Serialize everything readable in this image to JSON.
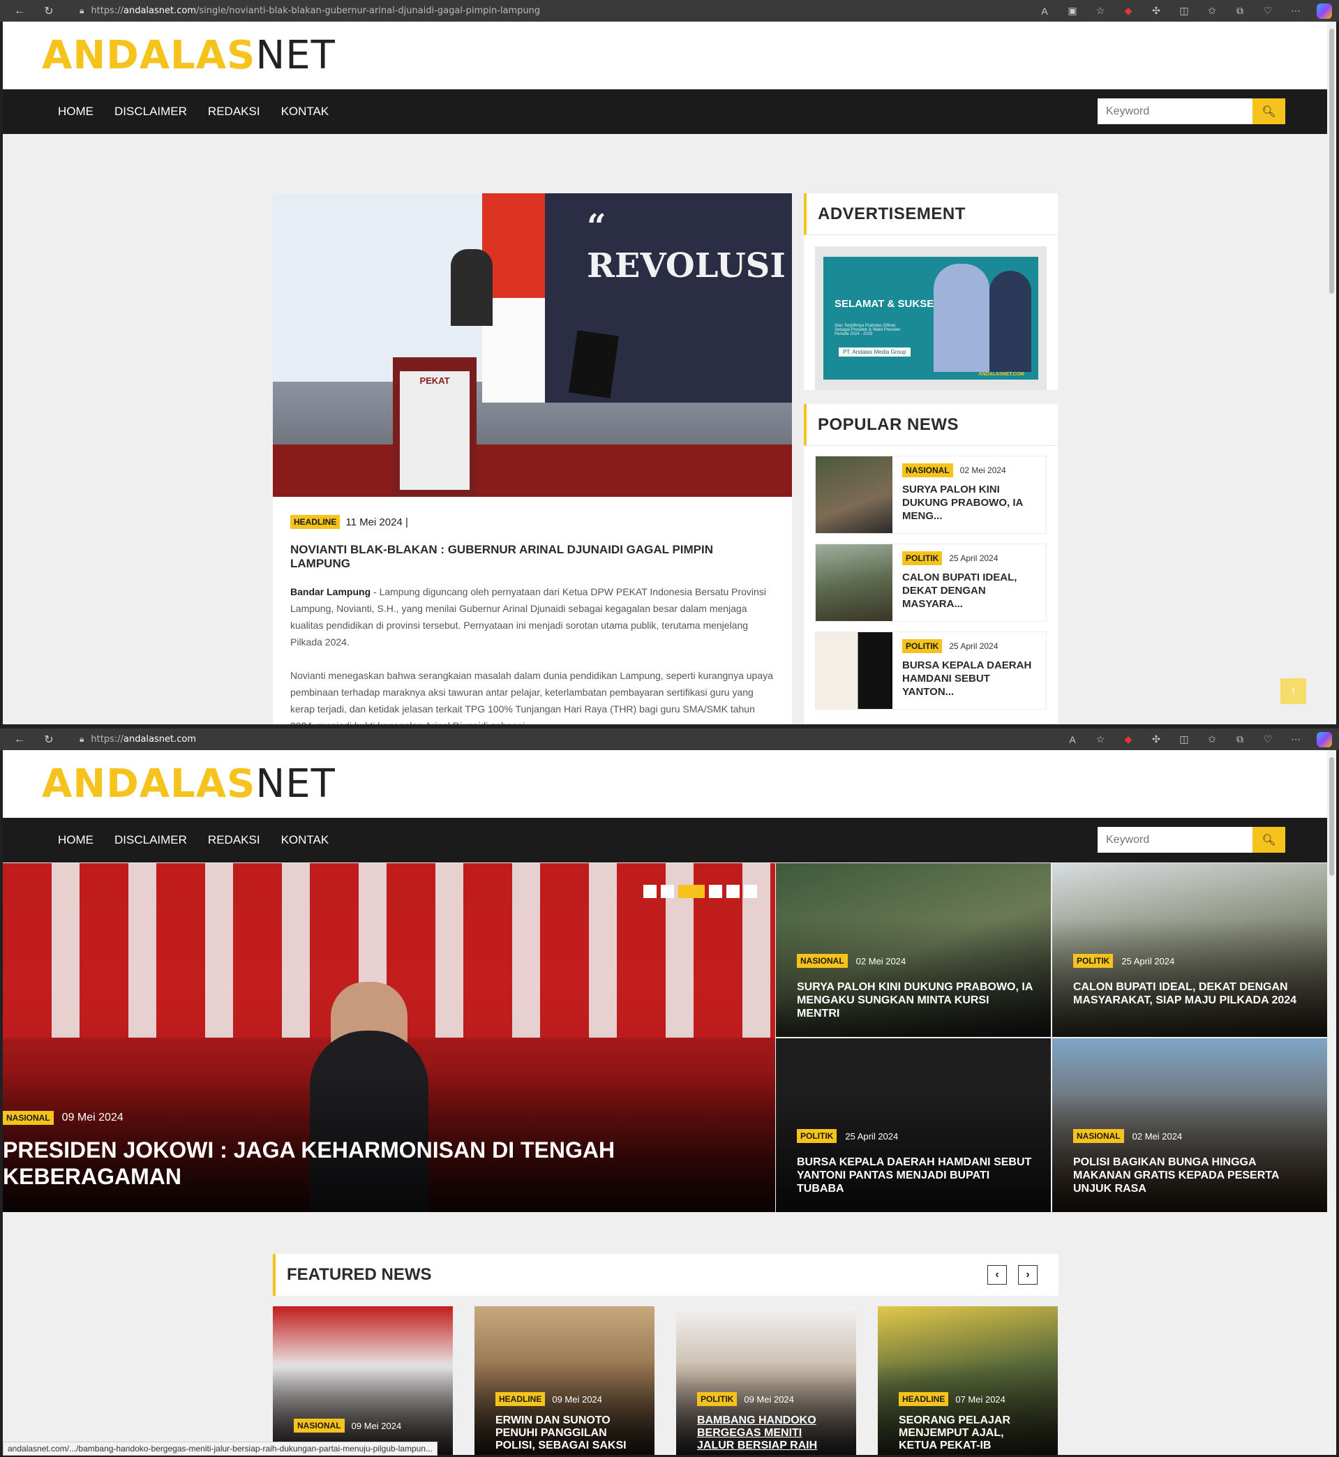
{
  "browser_top": {
    "url_prefix": "https://",
    "url_domain": "andalasnet.com",
    "url_path": "/single/novianti-blak-blakan-gubernur-arinal-djunaidi-gagal-pimpin-lampung"
  },
  "browser_bottom": {
    "url_prefix": "https://",
    "url_domain": "andalasnet.com",
    "url_path": ""
  },
  "site": {
    "logo_yellow": "ANDALAS",
    "logo_dark": "NET",
    "nav": [
      "HOME",
      "DISCLAIMER",
      "REDAKSI",
      "KONTAK"
    ],
    "search_placeholder": "Keyword",
    "accent_color": "#f6c21c"
  },
  "article": {
    "category": "HEADLINE",
    "date": "11 Mei 2024 |",
    "title": "NOVIANTI BLAK-BLAKAN : GUBERNUR ARINAL DJUNAIDI GAGAL PIMPIN LAMPUNG",
    "banner_text": "“ REVOLUSI",
    "podium_text": "PEKAT",
    "lead_location": "Bandar Lampung",
    "para1": " - Lampung diguncang oleh pernyataan dari Ketua DPW PEKAT Indonesia Bersatu Provinsi Lampung, Novianti, S.H., yang menilai Gubernur Arinal Djunaidi sebagai kegagalan besar dalam menjaga kualitas pendidikan di provinsi tersebut. Pernyataan ini menjadi sorotan utama publik, terutama menjelang Pilkada 2024.",
    "para2": "Novianti menegaskan bahwa serangkaian masalah dalam dunia pendidikan Lampung, seperti kurangnya upaya pembinaan terhadap maraknya aksi tawuran antar pelajar, keterlambatan pembayaran sertifikasi guru yang kerap terjadi, dan ketidak jelasan terkait TPG 100% Tunjangan Hari Raya (THR) bagi guru SMA/SMK tahun 2024, menjadi bukti kegagalan Arinal Djunaidi sebagai"
  },
  "sidebar": {
    "advertisement_title": "ADVERTISEMENT",
    "ad": {
      "headline": "SELAMAT & SUKSES",
      "sub": "Atas Terpilihnya Prabowo-Gibran Sebagai Presiden & Wakil Presiden Periode 2024 - 2029",
      "company": "PT. Andalas Media Group",
      "footer": "ANDALASNET.COM"
    },
    "popular_title": "POPULAR NEWS",
    "popular": [
      {
        "category": "NASIONAL",
        "date": "02 Mei 2024",
        "title": "SURYA PALOH KINI DUKUNG PRABOWO, IA MENG..."
      },
      {
        "category": "POLITIK",
        "date": "25 April 2024",
        "title": "CALON BUPATI IDEAL, DEKAT DENGAN MASYARA..."
      },
      {
        "category": "POLITIK",
        "date": "25 April 2024",
        "title": "BURSA KEPALA DAERAH HAMDANI SEBUT YANTON..."
      }
    ]
  },
  "home": {
    "main_slide": {
      "category": "NASIONAL",
      "date": "09 Mei 2024",
      "title": "PRESIDEN JOKOWI : JAGA KEHARMONISAN DI TENGAH KEBERAGAMAN"
    },
    "tiles": [
      {
        "category": "NASIONAL",
        "date": "02 Mei 2024",
        "title": "SURYA PALOH KINI DUKUNG PRABOWO, IA MENGAKU SUNGKAN MINTA KURSI MENTRI"
      },
      {
        "category": "POLITIK",
        "date": "25 April 2024",
        "title": "CALON BUPATI IDEAL, DEKAT DENGAN MASYARAKAT, SIAP MAJU PILKADA 2024"
      },
      {
        "category": "POLITIK",
        "date": "25 April 2024",
        "title": "BURSA KEPALA DAERAH HAMDANI SEBUT YANTONI PANTAS MENJADI BUPATI TUBABA"
      },
      {
        "category": "NASIONAL",
        "date": "02 Mei 2024",
        "title": "POLISI BAGIKAN BUNGA HINGGA MAKANAN GRATIS KEPADA PESERTA UNJUK RASA"
      }
    ],
    "featured_title": "FEATURED NEWS",
    "featured": [
      {
        "category": "NASIONAL",
        "date": "09 Mei 2024",
        "title": ""
      },
      {
        "category": "HEADLINE",
        "date": "09 Mei 2024",
        "title": "ERWIN DAN SUNOTO PENUHI PANGGILAN POLISI, SEBAGAI SAKSI"
      },
      {
        "category": "POLITIK",
        "date": "09 Mei 2024",
        "title": "BAMBANG HANDOKO BERGEGAS MENITI JALUR BERSIAP RAIH"
      },
      {
        "category": "HEADLINE",
        "date": "07 Mei 2024",
        "title": "SEORANG PELAJAR MENJEMPUT AJAL, KETUA PEKAT-IB"
      }
    ]
  },
  "status_url": "andalasnet.com/.../bambang-handoko-bergegas-meniti-jalur-bersiap-raih-dukungan-partai-menuju-pilgub-lampun..."
}
